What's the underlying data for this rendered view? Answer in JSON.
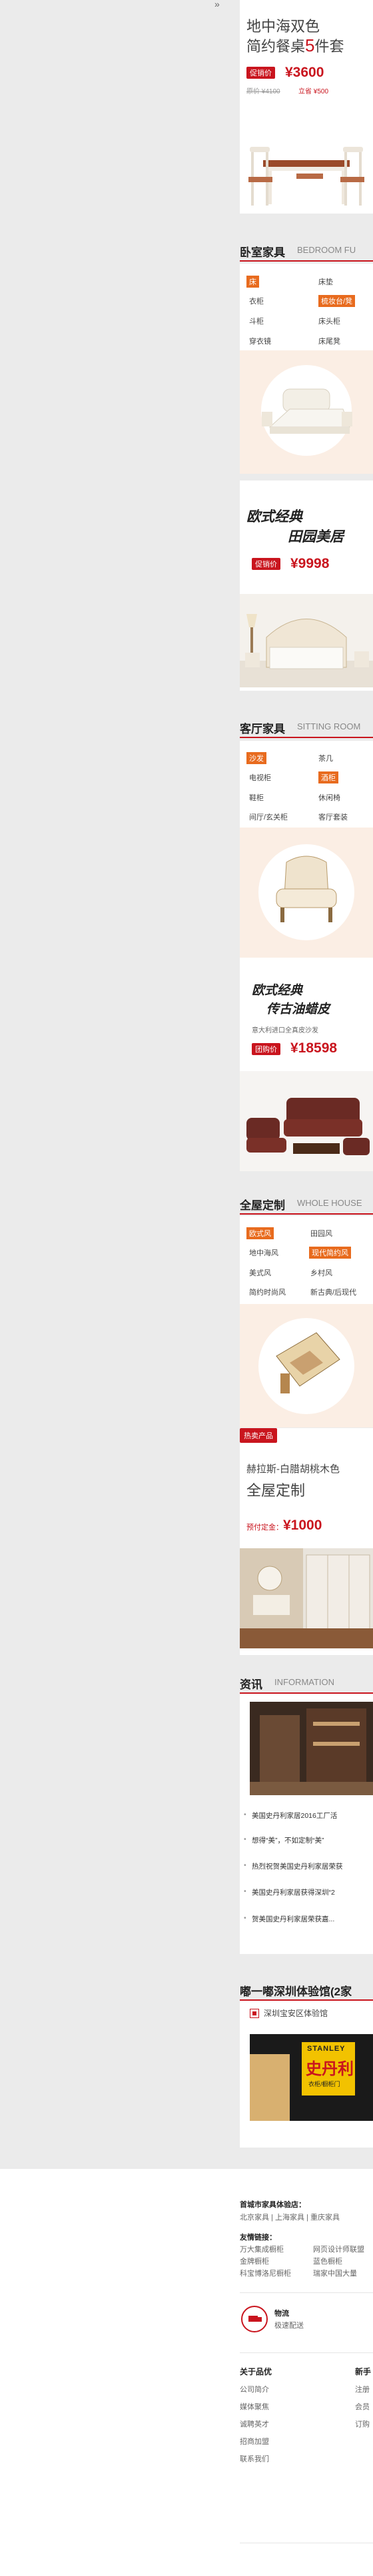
{
  "top": {
    "expand_glyph": "»",
    "title_line1": "地中海双色",
    "title_line2_prefix": "简约餐桌",
    "title_line2_num": "5",
    "title_line2_suffix": "件套",
    "promo_tag": "促销价",
    "promo_price": "¥3600",
    "original": "原价 ¥4100",
    "save": "立省 ¥500"
  },
  "bedroom": {
    "cn": "卧室家具",
    "en": "BEDROOM FU",
    "links": [
      "床",
      "床垫",
      "衣柜",
      "梳妆台/凳",
      "斗柜",
      "床头柜",
      "穿衣镜",
      "床尾凳"
    ],
    "slogan1": "欧式经典",
    "slogan2": "田园美居",
    "promo_tag": "促销价",
    "promo_price": "¥9998"
  },
  "living": {
    "cn": "客厅家具",
    "en": "SITTING ROOM",
    "links": [
      "沙发",
      "茶几",
      "电视柜",
      "酒柜",
      "鞋柜",
      "休闲椅",
      "间厅/玄关柜",
      "客厅套装"
    ],
    "slogan1": "欧式经典",
    "slogan2": "传古油蜡皮",
    "sub": "意大利进口全真皮沙发",
    "promo_tag": "团购价",
    "promo_price": "¥18598"
  },
  "custom": {
    "cn": "全屋定制",
    "en": "WHOLE HOUSE",
    "links": [
      "欧式风",
      "田园风",
      "地中海风",
      "现代简约风",
      "美式风",
      "乡村风",
      "简约时尚风",
      "新古典/后现代"
    ],
    "hot_tag": "热卖产品",
    "product_line1": "赫拉斯-白腊胡桃木色",
    "product_line2": "全屋定制",
    "deposit_label": "预付定金：",
    "deposit_price": "¥1000"
  },
  "news": {
    "cn": "资讯",
    "en": "INFORMATION",
    "items": [
      "美国史丹利家居2016工厂活",
      "想得“美”，不如定制“美”",
      "热烈祝贺美国史丹利家居荣获",
      "美国史丹利家居获得深圳“2",
      "贺美国史丹利家居荣获嘉..."
    ]
  },
  "stores": {
    "title": "嘟一嘟深圳体验馆(2家",
    "item": "深圳宝安区体验馆",
    "sign_brand": "STANLEY",
    "sign_cn": "史丹利",
    "sign_sub": "衣柜/橱柜门"
  },
  "footer": {
    "stores_title": "首城市家具体验店：",
    "stores_line": "北京家具 | 上海家具 | 重庆家具",
    "friend_title": "友情链接：",
    "friend_links": [
      "万大集成橱柜",
      "网页设计师联盟",
      "金牌橱柜",
      "蓝色橱柜",
      "科宝博洛尼橱柜",
      "瑞家中国大量"
    ],
    "logistics_title": "物流",
    "logistics_sub": "极速配送",
    "about_title": "关于品优",
    "about_links": [
      "公司简介",
      "媒体聚焦",
      "诚聘英才",
      "招商加盟",
      "联系我们"
    ],
    "newbie_title": "新手",
    "newbie_links": [
      "注册",
      "会员",
      "订购"
    ]
  }
}
